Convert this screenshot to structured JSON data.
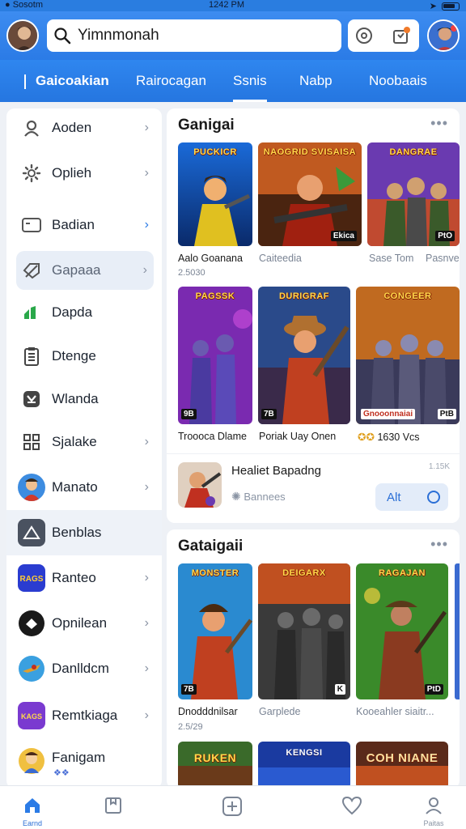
{
  "status_bar": {
    "carrier": "● Sosotm",
    "time": "1242 PM"
  },
  "search": {
    "value": "Yimnmonah"
  },
  "tabs": [
    {
      "label": "Gaicoakian"
    },
    {
      "label": "Rairocagan"
    },
    {
      "label": "Ssnis"
    },
    {
      "label": "Nabp"
    },
    {
      "label": "Noobaais"
    }
  ],
  "sidebar": {
    "items": [
      {
        "label": "Aoden",
        "icon": "user-icon"
      },
      {
        "label": "Oplieh",
        "icon": "gear-icon"
      },
      {
        "label": "Badian",
        "icon": "card-icon"
      },
      {
        "label": "Gapaaa",
        "icon": "tag-icon"
      },
      {
        "label": "Dapda",
        "icon": "chart-icon"
      },
      {
        "label": "Dtenge",
        "icon": "clipboard-icon"
      },
      {
        "label": "Wlanda",
        "icon": "shield-icon"
      },
      {
        "label": "Sjalake",
        "icon": "grid-icon"
      },
      {
        "label": "Manato",
        "icon": "game-avatar-icon"
      },
      {
        "label": "Benblas",
        "icon": "home-outline-icon"
      },
      {
        "label": "Ranteo",
        "icon": "game-logo-icon"
      },
      {
        "label": "Opnilean",
        "icon": "dark-app-icon"
      },
      {
        "label": "Danlldcm",
        "icon": "plane-app-icon"
      },
      {
        "label": "Remtkiaga",
        "icon": "purple-app-icon"
      },
      {
        "label": "Fanigam",
        "icon": "character-icon",
        "sub": "❖❖"
      }
    ]
  },
  "section1": {
    "title": "Ganigai",
    "games": [
      {
        "cover": "PUCKICR",
        "name": "Aalo Goanana",
        "sub": "2.5030"
      },
      {
        "cover": "NAOGRID SVISAISA",
        "name": "Caiteedia",
        "badge": "Ekica"
      },
      {
        "cover": "DANGRAE",
        "name": "Sase Tom",
        "extra": "Pasnve",
        "badge": "PtO"
      },
      {
        "cover": "PAGSSK",
        "name": "Troooca Dlame",
        "badge": "9B"
      },
      {
        "cover": "DURIGRAF",
        "name": "Poriak Uay Onen",
        "badge": "7B"
      },
      {
        "cover": "CONGEER",
        "name": "1630 Vcs",
        "badge": "Gnooonnaiai",
        "badge2": "PtB"
      }
    ],
    "featured": {
      "title": "Healiet Bapadng",
      "sub": "Bannees",
      "corner": "1.15K",
      "button": "Alt"
    }
  },
  "section2": {
    "title": "Gataigaii",
    "games": [
      {
        "cover": "MONSTER",
        "name": "Dnodddnilsar",
        "sub": "2.5/29",
        "badge": "7B"
      },
      {
        "cover": "DEIGARX",
        "name": "Garplede",
        "badge": "K"
      },
      {
        "cover": "RAGAJAN",
        "name": "Kooeahler siaitr...",
        "badge": "PtD"
      },
      {
        "cover": "RUKEN"
      },
      {
        "cover": "KENGSI"
      },
      {
        "cover": "COH NIANE"
      }
    ]
  },
  "bottom_nav": [
    {
      "label": "Earnd",
      "icon": "home-icon"
    },
    {
      "label": "",
      "icon": "bookmark-icon"
    },
    {
      "label": "",
      "icon": "plus-icon"
    },
    {
      "label": "",
      "icon": "heart-icon"
    },
    {
      "label": "Paitas",
      "icon": "profile-icon"
    }
  ],
  "colors": {
    "accent": "#2b7be6",
    "header_bg": "#3d8cf0"
  }
}
